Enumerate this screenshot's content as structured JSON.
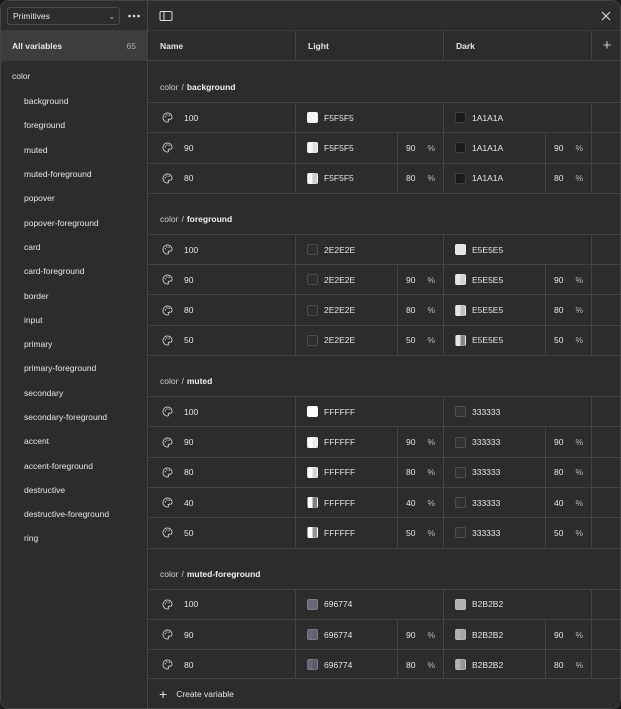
{
  "sidebar": {
    "collection": "Primitives",
    "all_variables_label": "All variables",
    "all_variables_count": "65",
    "group_label": "color",
    "items": [
      "background",
      "foreground",
      "muted",
      "muted-foreground",
      "popover",
      "popover-foreground",
      "card",
      "card-foreground",
      "border",
      "input",
      "primary",
      "primary-foreground",
      "secondary",
      "secondary-foreground",
      "accent",
      "accent-foreground",
      "destructive",
      "destructive-foreground",
      "ring"
    ]
  },
  "columns": {
    "name": "Name",
    "light": "Light",
    "dark": "Dark",
    "add": "+"
  },
  "groups": [
    {
      "prefix": "color",
      "sep": "/",
      "name": "background",
      "rows": [
        {
          "name": "100",
          "light": {
            "hex": "F5F5F5",
            "color": "#F5F5F5",
            "alpha": ""
          },
          "dark": {
            "hex": "1A1A1A",
            "color": "#1A1A1A",
            "alpha": ""
          }
        },
        {
          "name": "90",
          "light": {
            "hex": "F5F5F5",
            "color": "#F5F5F5",
            "alpha": "90"
          },
          "dark": {
            "hex": "1A1A1A",
            "color": "#1A1A1A",
            "alpha": "90"
          }
        },
        {
          "name": "80",
          "light": {
            "hex": "F5F5F5",
            "color": "#F5F5F5",
            "alpha": "80"
          },
          "dark": {
            "hex": "1A1A1A",
            "color": "#1A1A1A",
            "alpha": "80"
          }
        }
      ]
    },
    {
      "prefix": "color",
      "sep": "/",
      "name": "foreground",
      "rows": [
        {
          "name": "100",
          "light": {
            "hex": "2E2E2E",
            "color": "#2E2E2E",
            "alpha": ""
          },
          "dark": {
            "hex": "E5E5E5",
            "color": "#E5E5E5",
            "alpha": ""
          }
        },
        {
          "name": "90",
          "light": {
            "hex": "2E2E2E",
            "color": "#2E2E2E",
            "alpha": "90"
          },
          "dark": {
            "hex": "E5E5E5",
            "color": "#E5E5E5",
            "alpha": "90"
          }
        },
        {
          "name": "80",
          "light": {
            "hex": "2E2E2E",
            "color": "#2E2E2E",
            "alpha": "80"
          },
          "dark": {
            "hex": "E5E5E5",
            "color": "#E5E5E5",
            "alpha": "80"
          }
        },
        {
          "name": "50",
          "light": {
            "hex": "2E2E2E",
            "color": "#2E2E2E",
            "alpha": "50"
          },
          "dark": {
            "hex": "E5E5E5",
            "color": "#E5E5E5",
            "alpha": "50"
          }
        }
      ]
    },
    {
      "prefix": "color",
      "sep": "/",
      "name": "muted",
      "rows": [
        {
          "name": "100",
          "light": {
            "hex": "FFFFFF",
            "color": "#FFFFFF",
            "alpha": ""
          },
          "dark": {
            "hex": "333333",
            "color": "#333333",
            "alpha": ""
          }
        },
        {
          "name": "90",
          "light": {
            "hex": "FFFFFF",
            "color": "#FFFFFF",
            "alpha": "90"
          },
          "dark": {
            "hex": "333333",
            "color": "#333333",
            "alpha": "90"
          }
        },
        {
          "name": "80",
          "light": {
            "hex": "FFFFFF",
            "color": "#FFFFFF",
            "alpha": "80"
          },
          "dark": {
            "hex": "333333",
            "color": "#333333",
            "alpha": "80"
          }
        },
        {
          "name": "40",
          "light": {
            "hex": "FFFFFF",
            "color": "#FFFFFF",
            "alpha": "40"
          },
          "dark": {
            "hex": "333333",
            "color": "#333333",
            "alpha": "40"
          }
        },
        {
          "name": "50",
          "light": {
            "hex": "FFFFFF",
            "color": "#FFFFFF",
            "alpha": "50"
          },
          "dark": {
            "hex": "333333",
            "color": "#333333",
            "alpha": "50"
          }
        }
      ]
    },
    {
      "prefix": "color",
      "sep": "/",
      "name": "muted-foreground",
      "rows": [
        {
          "name": "100",
          "light": {
            "hex": "696774",
            "color": "#696774",
            "alpha": ""
          },
          "dark": {
            "hex": "B2B2B2",
            "color": "#B2B2B2",
            "alpha": ""
          }
        },
        {
          "name": "90",
          "light": {
            "hex": "696774",
            "color": "#696774",
            "alpha": "90"
          },
          "dark": {
            "hex": "B2B2B2",
            "color": "#B2B2B2",
            "alpha": "90"
          }
        },
        {
          "name": "80",
          "light": {
            "hex": "696774",
            "color": "#696774",
            "alpha": "80"
          },
          "dark": {
            "hex": "B2B2B2",
            "color": "#B2B2B2",
            "alpha": "80"
          }
        }
      ]
    }
  ],
  "percent_sign": "%",
  "footer": {
    "create_label": "Create variable"
  },
  "icons": {
    "palette": "palette-icon",
    "panel_toggle": "sidebar-toggle-icon",
    "close": "close-icon",
    "more": "more-icon",
    "plus": "plus-icon"
  }
}
